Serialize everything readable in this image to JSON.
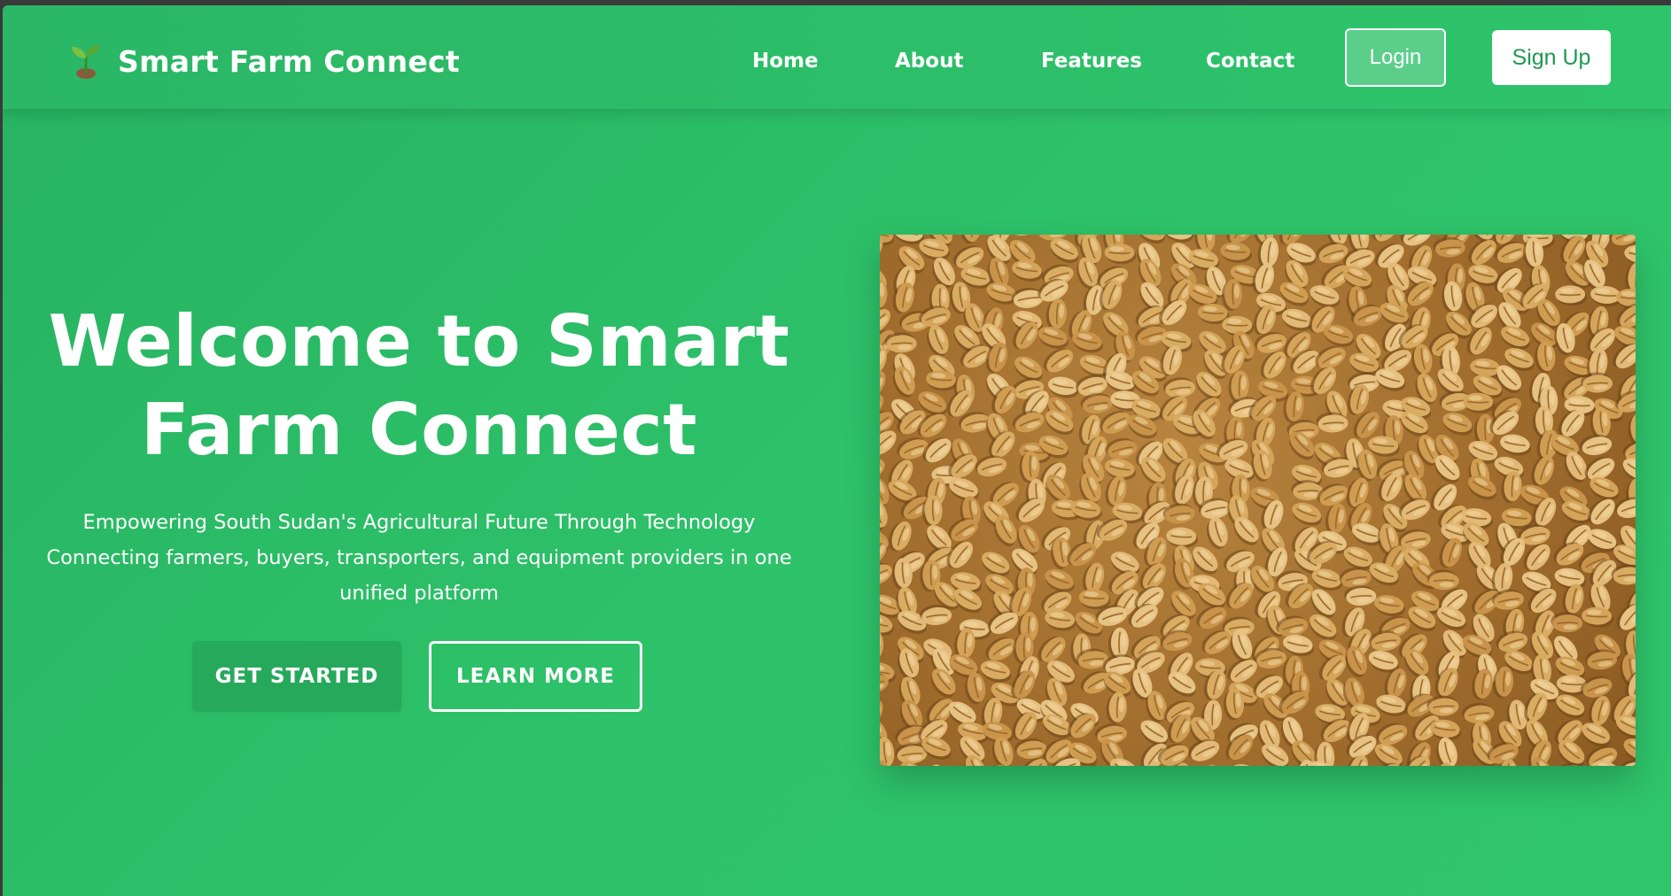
{
  "brand": {
    "name": "Smart Farm Connect",
    "logo_icon": "seedling-icon"
  },
  "nav": {
    "links": [
      {
        "label": "Home"
      },
      {
        "label": "About"
      },
      {
        "label": "Features"
      },
      {
        "label": "Contact"
      }
    ],
    "login_label": "Login",
    "signup_label": "Sign Up"
  },
  "hero": {
    "title": "Welcome to Smart Farm Connect",
    "subtitle_line1": "Empowering South Sudan's Agricultural Future Through Technology",
    "subtitle_line2": "Connecting farmers, buyers, transporters, and equipment providers in one unified platform",
    "primary_cta": "GET STARTED",
    "secondary_cta": "LEARN MORE",
    "image": "wheat-grains-photo"
  },
  "colors": {
    "background": "#2ec06a",
    "navbar": "#2bb766",
    "primary_button": "#27a95c",
    "signup_text": "#1f9a52",
    "text": "#ffffff"
  }
}
